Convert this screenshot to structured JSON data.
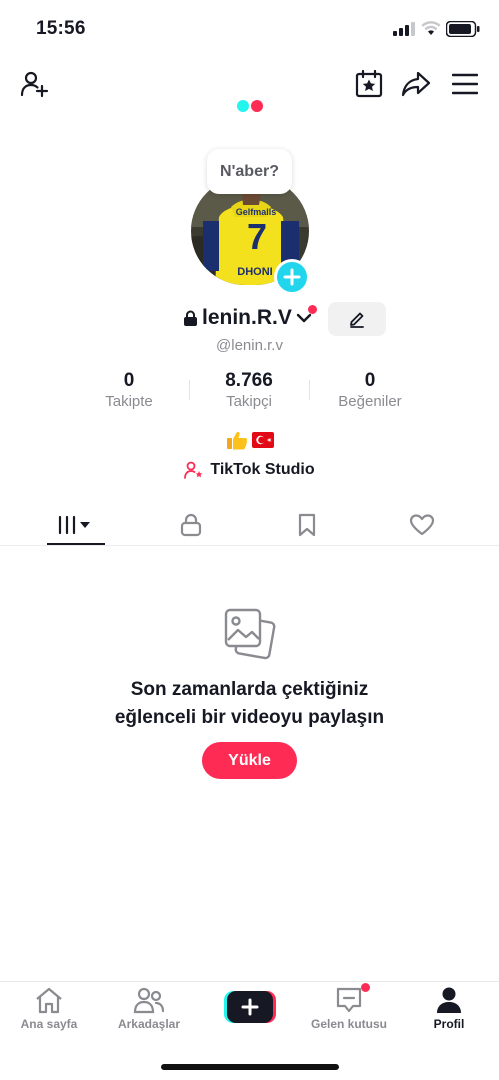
{
  "status_bar": {
    "time": "15:56"
  },
  "header": {
    "icons": [
      "add-user-icon",
      "calendar-star-icon",
      "share-icon",
      "menu-icon"
    ]
  },
  "profile": {
    "bubble_text": "N'aber?",
    "display_name": "lenin.R.V",
    "handle": "@lenin.r.v",
    "avatar_jersey_brand": "Gelfmalls",
    "avatar_jersey_number": "7",
    "avatar_jersey_name": "DHONI"
  },
  "stats": [
    {
      "value": "0",
      "label": "Takipte"
    },
    {
      "value": "8.766",
      "label": "Takipçi"
    },
    {
      "value": "0",
      "label": "Beğeniler"
    }
  ],
  "bio": {
    "emojis": [
      "thumbs-up",
      "turkey-flag"
    ]
  },
  "studio": {
    "label": "TikTok Studio"
  },
  "tabs": [
    "videos-tab",
    "private-tab",
    "saved-tab",
    "liked-tab"
  ],
  "empty_state": {
    "line1": "Son zamanlarda çektiğiniz",
    "line2": "eğlenceli bir videoyu paylaşın",
    "button": "Yükle"
  },
  "nav": {
    "home": "Ana sayfa",
    "friends": "Arkadaşlar",
    "inbox": "Gelen kutusu",
    "profile": "Profil"
  },
  "colors": {
    "accent": "#fe2c55",
    "cyan": "#20d5ec",
    "text": "#161823",
    "muted": "#8a8b91"
  }
}
